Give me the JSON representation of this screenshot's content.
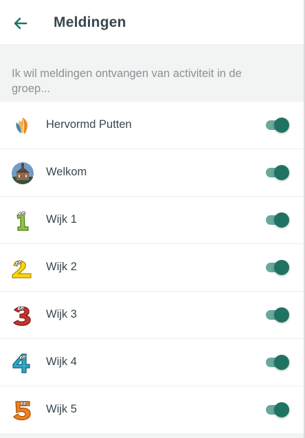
{
  "header": {
    "title": "Meldingen",
    "back_icon": "arrow-left-icon",
    "accent_color": "#1e7363"
  },
  "section": {
    "text": "Ik wil meldingen ontvangen van activiteit in de groep..."
  },
  "groups": [
    {
      "label": "Hervormd Putten",
      "icon": "church-logo-icon",
      "enabled": true
    },
    {
      "label": "Welkom",
      "icon": "church-photo-avatar",
      "enabled": true
    },
    {
      "label": "Wijk 1",
      "icon": "number-1-icon",
      "enabled": true
    },
    {
      "label": "Wijk 2",
      "icon": "number-2-icon",
      "enabled": true
    },
    {
      "label": "Wijk 3",
      "icon": "number-3-icon",
      "enabled": true
    },
    {
      "label": "Wijk 4",
      "icon": "number-4-icon",
      "enabled": true
    },
    {
      "label": "Wijk 5",
      "icon": "number-5-icon",
      "enabled": true
    }
  ]
}
